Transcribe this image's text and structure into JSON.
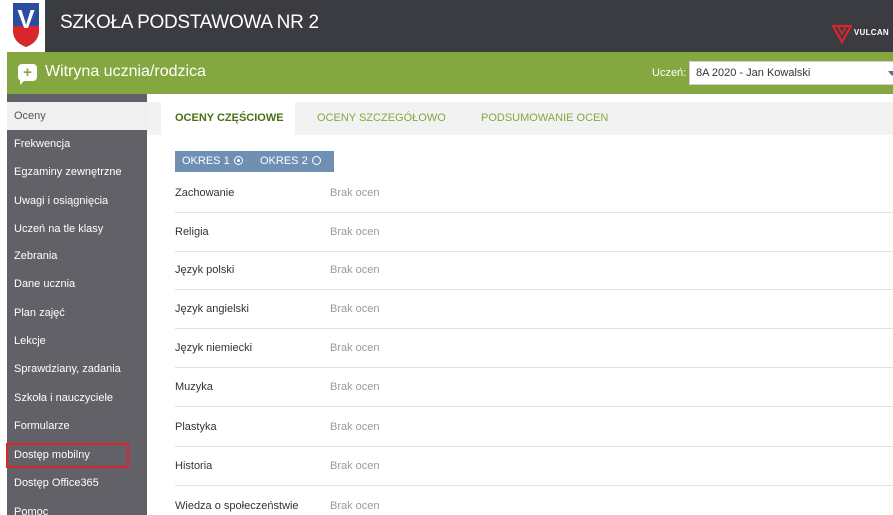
{
  "header": {
    "school_name": "SZKOŁA PODSTAWOWA NR 2",
    "logo_letter": "V",
    "brand": "VULCAN"
  },
  "portal": {
    "title": "Witryna ucznia/rodzica",
    "icon": "plus-chat-icon",
    "student_label": "Uczeń:",
    "student_selected": "8A 2020 - Jan Kowalski"
  },
  "sidebar": {
    "items": [
      {
        "label": "Oceny",
        "active": true
      },
      {
        "label": "Frekwencja"
      },
      {
        "label": "Egzaminy zewnętrzne"
      },
      {
        "label": "Uwagi i osiągnięcia"
      },
      {
        "label": "Uczeń na tle klasy"
      },
      {
        "label": "Zebrania"
      },
      {
        "label": "Dane ucznia"
      },
      {
        "label": "Plan zajęć"
      },
      {
        "label": "Lekcje"
      },
      {
        "label": "Sprawdziany, zadania"
      },
      {
        "label": "Szkoła i nauczyciele"
      },
      {
        "label": "Formularze"
      },
      {
        "label": "Dostęp mobilny",
        "highlighted": true
      },
      {
        "label": "Dostęp Office365"
      },
      {
        "label": "Pomoc"
      }
    ]
  },
  "tabs": [
    {
      "label": "OCENY CZĘŚCIOWE",
      "active": true
    },
    {
      "label": "OCENY SZCZEGÓŁOWO"
    },
    {
      "label": "PODSUMOWANIE OCEN"
    }
  ],
  "periods": [
    {
      "label": "OKRES 1",
      "selected": true
    },
    {
      "label": "OKRES 2",
      "selected": false
    }
  ],
  "grades": [
    {
      "subject": "Zachowanie",
      "value": "Brak ocen"
    },
    {
      "subject": "Religia",
      "value": "Brak ocen"
    },
    {
      "subject": "Język polski",
      "value": "Brak ocen"
    },
    {
      "subject": "Język angielski",
      "value": "Brak ocen"
    },
    {
      "subject": "Język niemiecki",
      "value": "Brak ocen"
    },
    {
      "subject": "Muzyka",
      "value": "Brak ocen"
    },
    {
      "subject": "Plastyka",
      "value": "Brak ocen"
    },
    {
      "subject": "Historia",
      "value": "Brak ocen"
    },
    {
      "subject": "Wiedza o społeczeństwie",
      "value": "Brak ocen"
    }
  ],
  "colors": {
    "header_bg": "#3b3c41",
    "green": "#84a83f",
    "sidebar_bg": "#616167",
    "period_bg": "#6f8fb3",
    "highlight": "#d9262c"
  }
}
